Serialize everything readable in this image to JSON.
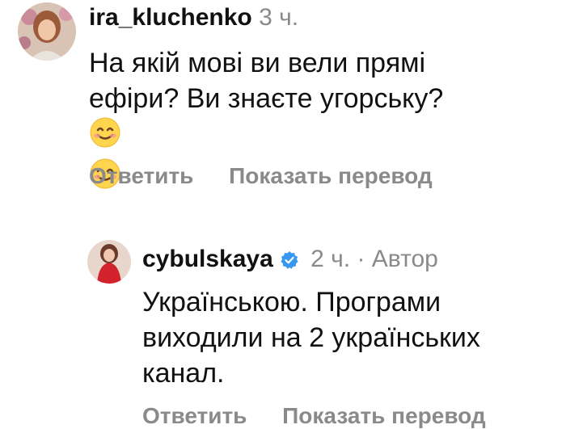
{
  "comment1": {
    "username": "ira_kluchenko",
    "time": "3 ч.",
    "text_line1": "На якій мові ви вели прямі",
    "text_line2": "ефіри? Ви знаєте угорську?",
    "emoji": "smiling-face-emoji",
    "reply_label": "Ответить",
    "translate_label": "Показать перевод"
  },
  "comment2": {
    "username": "cybulskaya",
    "verified": true,
    "time": "2 ч.",
    "separator": "·",
    "author_label": "Автор",
    "text_line1": "Українською. Програми",
    "text_line2": "виходили на 2 українських",
    "text_line3": "канал.",
    "reply_label": "Ответить",
    "translate_label": "Показать перевод"
  },
  "colors": {
    "verified": "#3897f0",
    "meta": "#8a8a8a"
  }
}
